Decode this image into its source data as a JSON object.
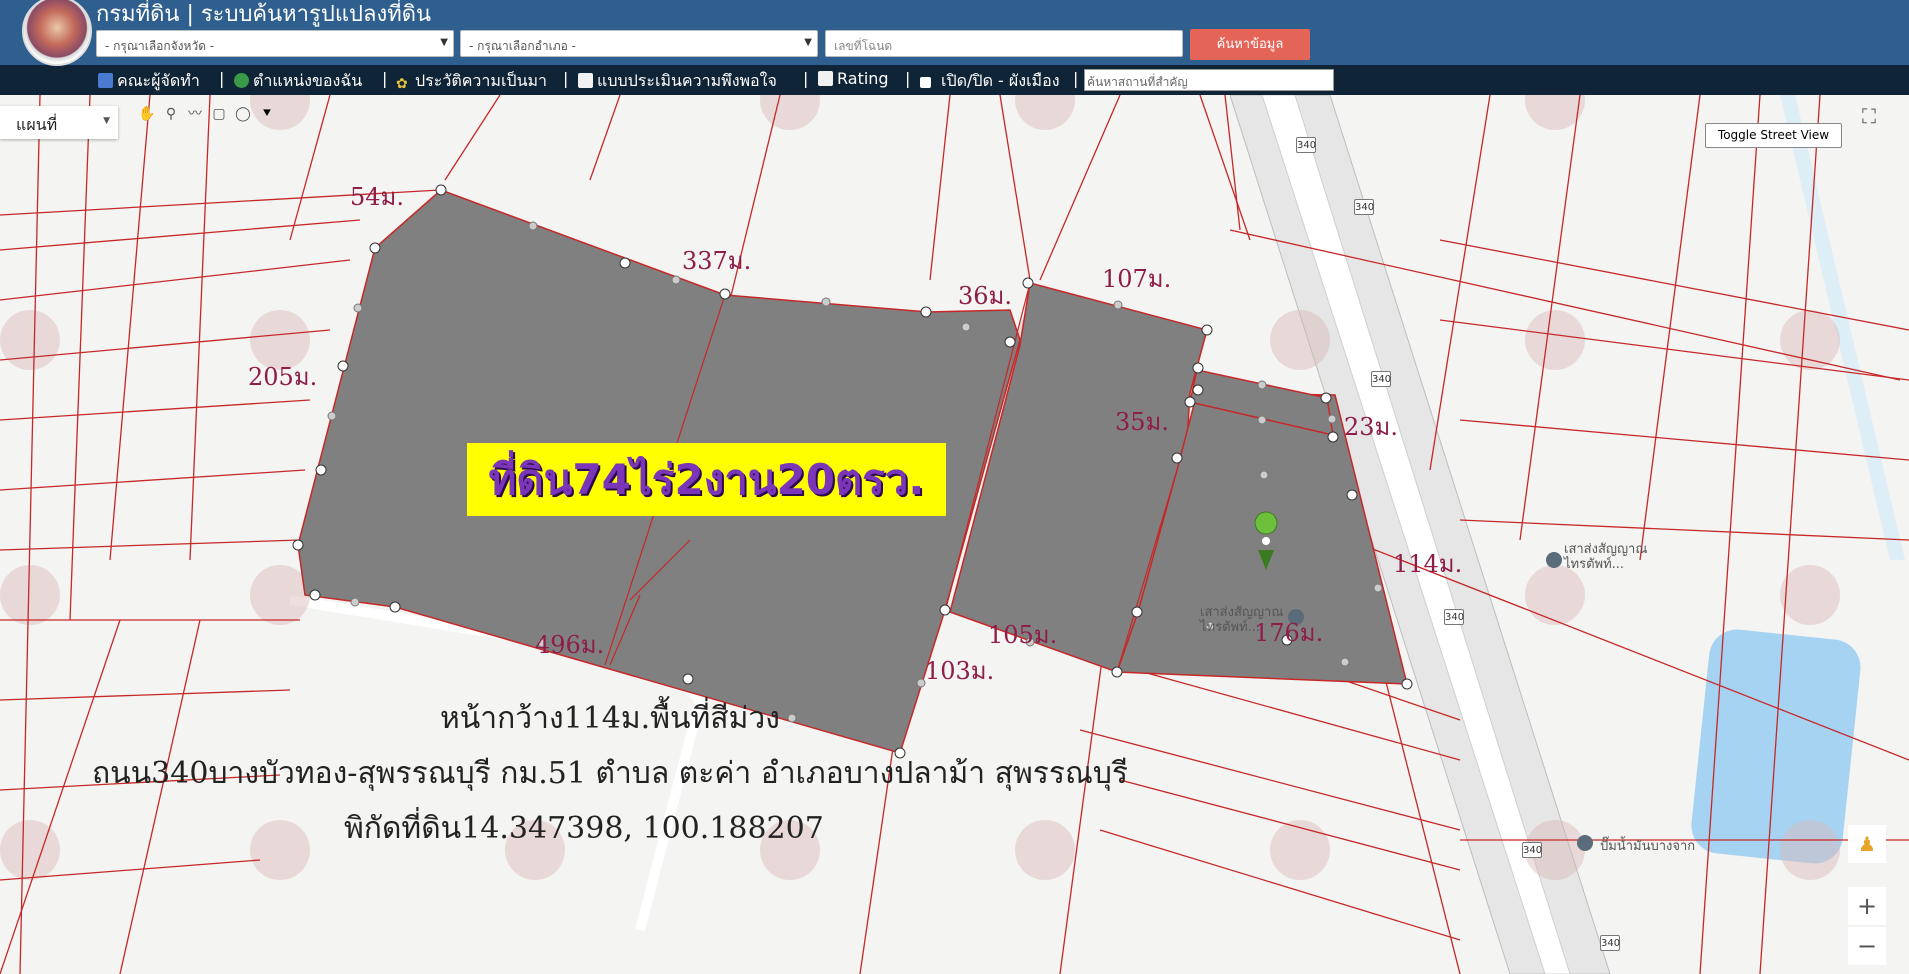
{
  "header": {
    "title": "กรมที่ดิน | ระบบค้นหารูปแปลงที่ดิน",
    "province_select": "- กรุณาเลือกจังหวัด -",
    "district_select": "- กรุณาเลือกอำเภอ -",
    "deed_placeholder": "เลขที่โฉนด",
    "search_button": "ค้นหาข้อมูล"
  },
  "nav": {
    "items": [
      {
        "label": "คณะผู้จัดทำ",
        "icon": "team-icon"
      },
      {
        "label": "ตำแหน่งของฉัน",
        "icon": "globe-icon"
      },
      {
        "label": "ประวัติความเป็นมา",
        "icon": "sprout-icon"
      },
      {
        "label": "แบบประเมินความพึงพอใจ",
        "icon": "document-icon"
      },
      {
        "label": "Rating",
        "icon": "chart-icon"
      },
      {
        "label": "เปิด/ปิด - ผังเมือง",
        "icon": "checkbox-icon"
      }
    ],
    "separator": "|",
    "place_search_placeholder": "ค้นหาสถานที่สำคัญ"
  },
  "map": {
    "map_type": "แผนที่",
    "toggle_street_view": "Toggle Street View",
    "zoom_in": "+",
    "zoom_out": "−",
    "route_shield": "340",
    "poi": [
      {
        "label": "เสาส่งสัญญาณ ไทรตัพท์..."
      },
      {
        "label": "เสาส่งสัญญาณ ไทรตัพท์..."
      },
      {
        "label": "ปั๊มน้ำมันบางจาก"
      }
    ],
    "annotations": {
      "banner": "ที่ดิน74ไร่2งาน20ตรว.",
      "dims": [
        "54ม.",
        "337ม.",
        "36ม.",
        "107ม.",
        "205ม.",
        "35ม.",
        "23ม.",
        "114ม.",
        "105ม.",
        "176ม.",
        "496ม.",
        "103ม."
      ],
      "caption_line1": "หน้ากว้าง114ม.พื้นที่สีม่วง",
      "caption_line2": "ถนน340บางบัวทอง-สุพรรณบุรี กม.51 ตำบล ตะค่า อำเภอบางปลาม้า สุพรรณบุรี",
      "caption_line3": "พิกัดที่ดิน14.347398, 100.188207"
    }
  },
  "colors": {
    "header": "#2e5f8e",
    "navbar": "#0f2436",
    "search_button": "#e46458",
    "parcel_fill": "#808080",
    "parcel_line": "#c62828",
    "banner_bg": "#ffff00",
    "banner_text": "#7b35b8",
    "dim_text": "#8e1d4a"
  }
}
